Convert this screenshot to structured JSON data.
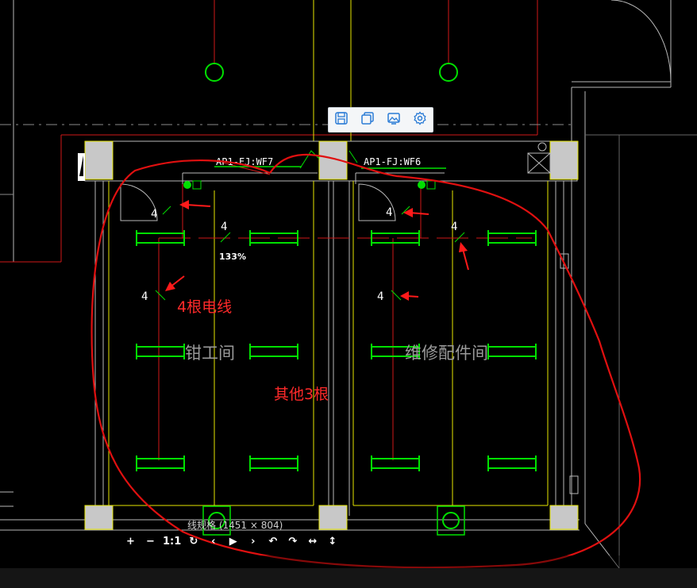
{
  "drawing": {
    "room_left_label": "钳工间",
    "room_right_label": "维修配件间",
    "circuit_left": "AP1-FJ:WF7",
    "circuit_right": "AP1-FJ:WF6",
    "wire_count_mark": "4",
    "zoom_badge": "133%"
  },
  "annotations": {
    "four_wires": "4根电线",
    "others_three": "其他3根"
  },
  "toolbar": {
    "buttons": [
      {
        "icon": "save-icon"
      },
      {
        "icon": "copy-icon"
      },
      {
        "icon": "image-icon"
      },
      {
        "icon": "settings-icon"
      }
    ]
  },
  "viewer": {
    "caption": "线规格 (1451 × 804)",
    "controls": {
      "zoom_in": "+",
      "zoom_out": "−",
      "actual_size": "1:1",
      "reset": "↻",
      "prev": "‹",
      "play": "▶",
      "next": "›",
      "rotate_left": "↶",
      "rotate_right": "↷",
      "flip_h": "↔",
      "flip_v": "↕"
    }
  },
  "colors": {
    "background": "#000000",
    "wall": "#b8b8b8",
    "yellow_line": "#e6e600",
    "red_line": "#d01818",
    "green_fixture": "#00e000",
    "annotation": "#ff2020"
  }
}
